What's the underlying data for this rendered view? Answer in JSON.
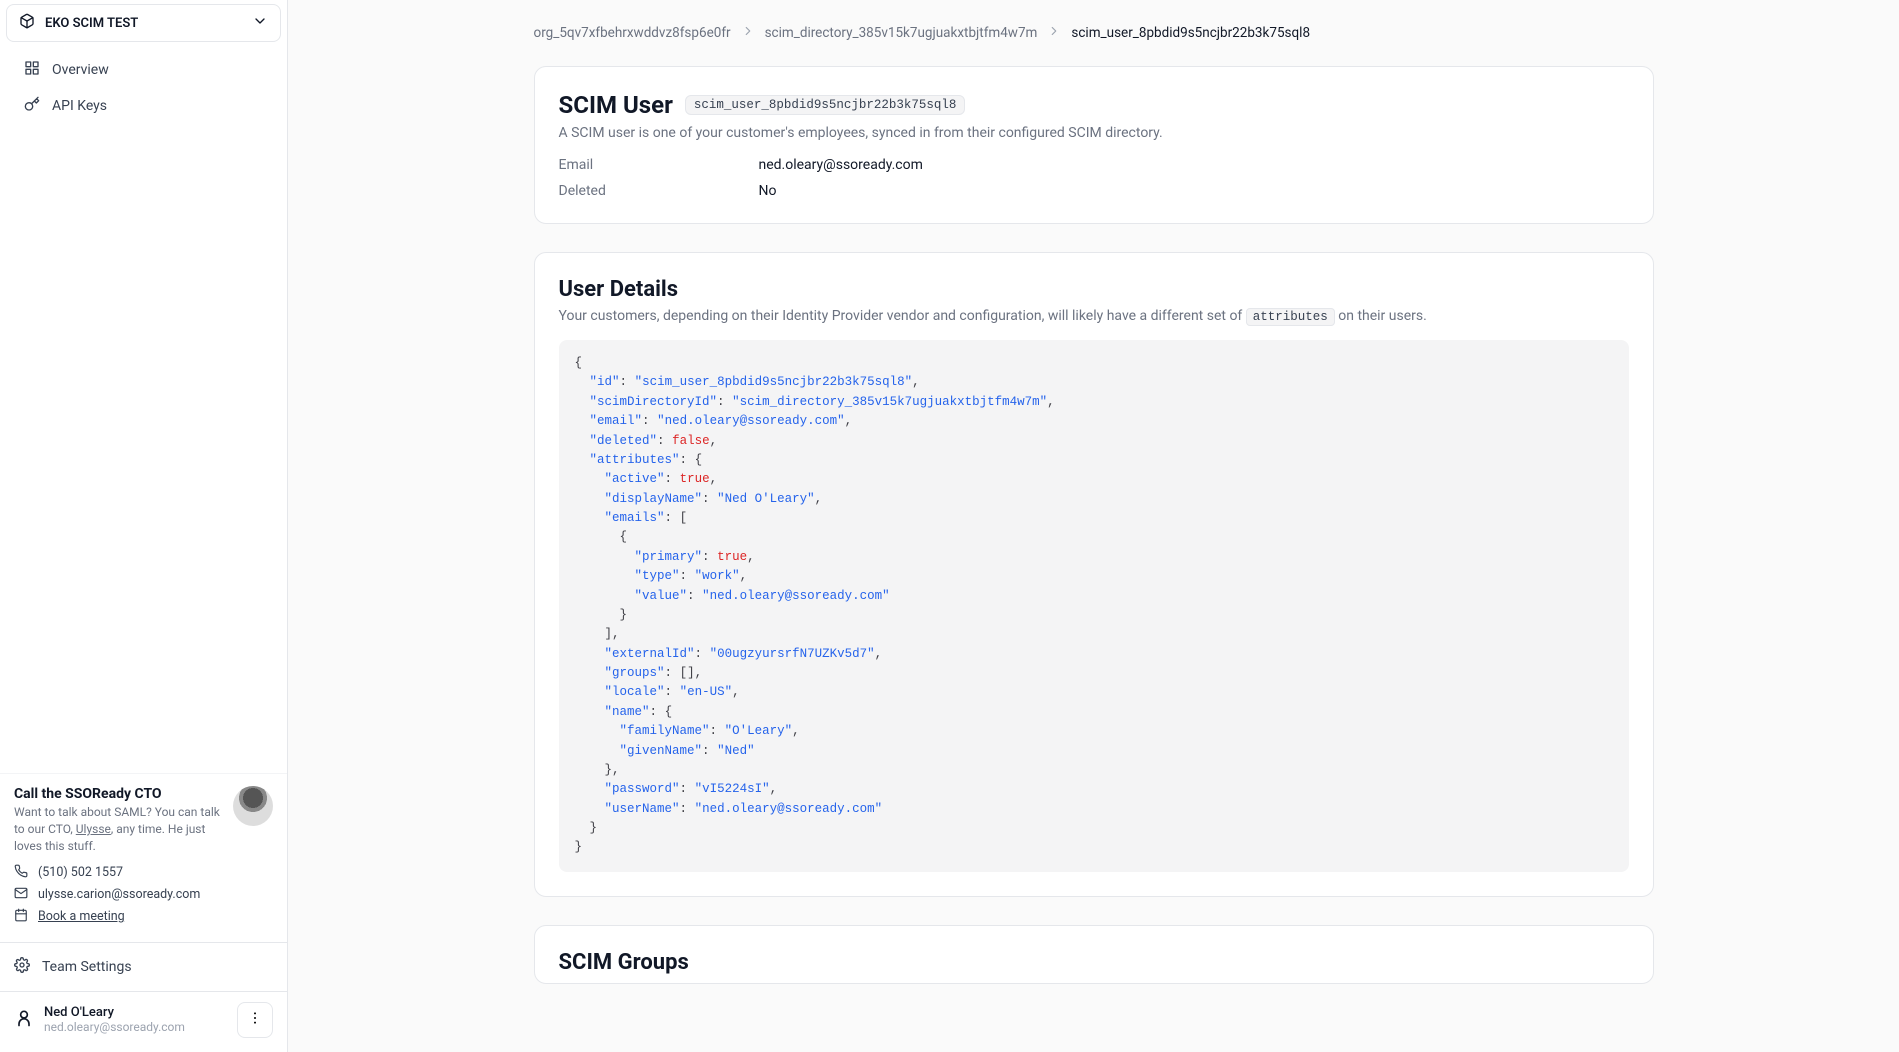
{
  "sidebar": {
    "project_name": "EKO SCIM TEST",
    "nav": {
      "overview_label": "Overview",
      "api_keys_label": "API Keys"
    },
    "cto": {
      "title": "Call the SSOReady CTO",
      "desc_pre": "Want to talk about SAML? You can talk to our CTO, ",
      "desc_link": "Ulysse",
      "desc_post": ", any time. He just loves this stuff.",
      "phone": "(510) 502 1557",
      "email": "ulysse.carion@ssoready.com",
      "meeting_label": "Book a meeting"
    },
    "team_settings_label": "Team Settings",
    "user": {
      "name": "Ned O'Leary",
      "email": "ned.oleary@ssoready.com"
    }
  },
  "breadcrumb": {
    "org": "org_5qv7xfbehrxwddvz8fsp6e0fr",
    "dir": "scim_directory_385v15k7ugjuakxtbjtfm4w7m",
    "user": "scim_user_8pbdid9s5ncjbr22b3k75sql8"
  },
  "scim_user_card": {
    "title": "SCIM User",
    "id_badge": "scim_user_8pbdid9s5ncjbr22b3k75sql8",
    "subtitle": "A SCIM user is one of your customer's employees, synced in from their configured SCIM directory.",
    "labels": {
      "email": "Email",
      "deleted": "Deleted"
    },
    "values": {
      "email": "ned.oleary@ssoready.com",
      "deleted": "No"
    }
  },
  "user_details_card": {
    "title": "User Details",
    "sub_pre": "Your customers, depending on their Identity Provider vendor and configuration, will likely have a different set of ",
    "sub_code": "attributes",
    "sub_post": " on their users."
  },
  "user_details_json": {
    "id": "scim_user_8pbdid9s5ncjbr22b3k75sql8",
    "scimDirectoryId": "scim_directory_385v15k7ugjuakxtbjtfm4w7m",
    "email": "ned.oleary@ssoready.com",
    "deleted": false,
    "attributes": {
      "active": true,
      "displayName": "Ned O'Leary",
      "emails": [
        {
          "primary": true,
          "type": "work",
          "value": "ned.oleary@ssoready.com"
        }
      ],
      "externalId": "00ugzyursrfN7UZKv5d7",
      "groups": [],
      "locale": "en-US",
      "name": {
        "familyName": "O'Leary",
        "givenName": "Ned"
      },
      "password": "vI5224sI",
      "userName": "ned.oleary@ssoready.com"
    }
  },
  "scim_groups_card": {
    "title": "SCIM Groups"
  }
}
